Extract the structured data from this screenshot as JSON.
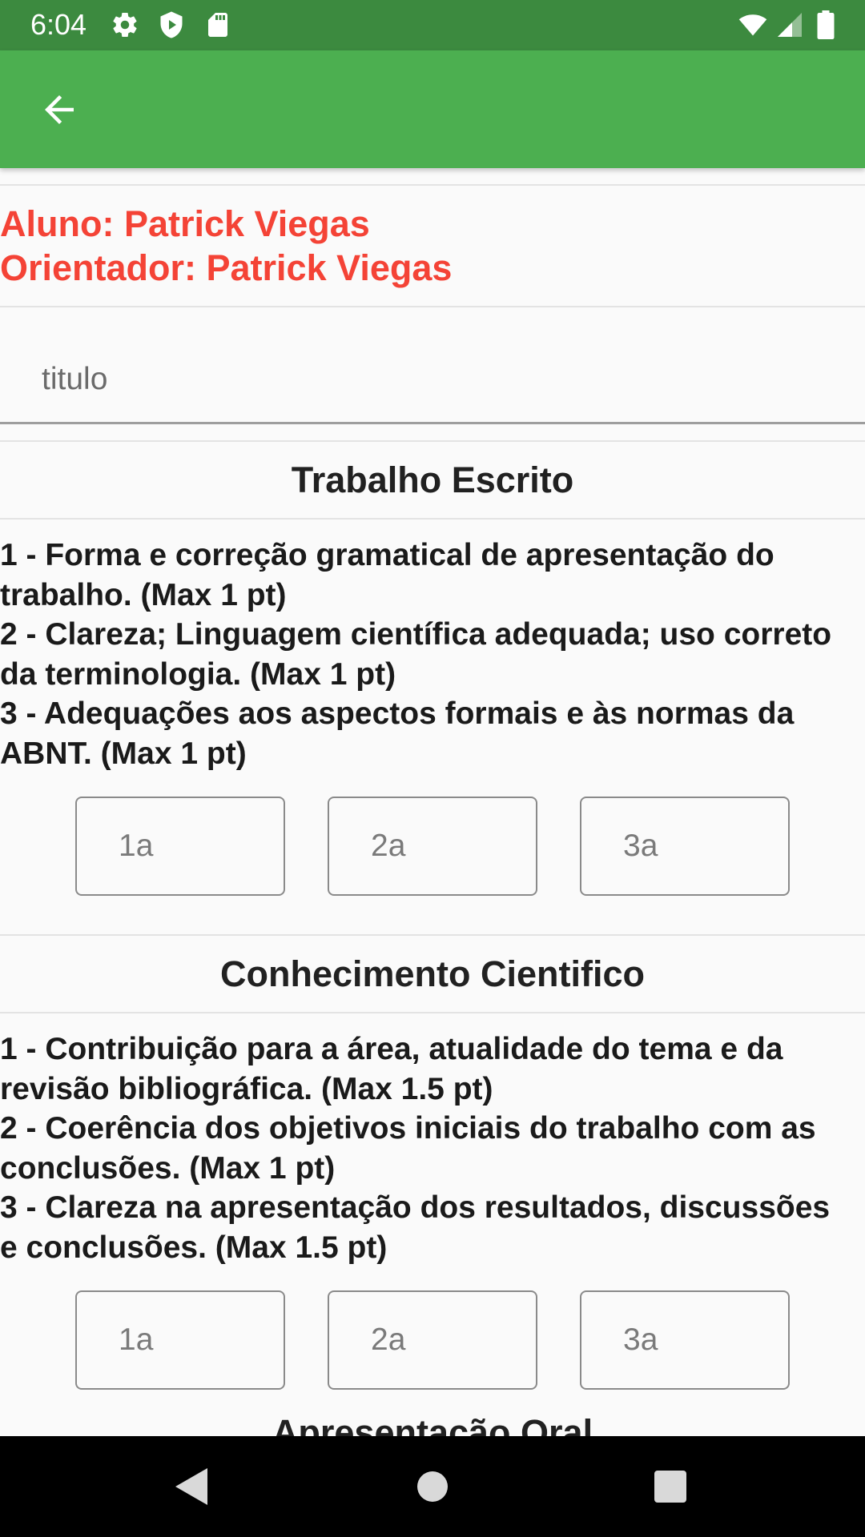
{
  "status_bar": {
    "time": "6:04",
    "left_icons": [
      "gear-icon",
      "shield-icon",
      "sd-card-icon"
    ],
    "right_icons": [
      "wifi-icon",
      "signal-icon",
      "battery-icon"
    ],
    "background": "#3c8a3f"
  },
  "app_bar": {
    "background": "#4caf50",
    "back_icon": "arrow-back-icon"
  },
  "student": {
    "aluno": "Aluno: Patrick Viegas",
    "orientador": "Orientador: Patrick Viegas",
    "color": "#f44336"
  },
  "title_field": {
    "placeholder": "titulo",
    "value": ""
  },
  "sections": [
    {
      "title": "Trabalho Escrito",
      "criteria": [
        "1 - Forma e correção gramatical de apresentação do",
        "trabalho. (Max 1 pt)",
        "2 - Clareza; Linguagem científica adequada; uso correto",
        "da terminologia. (Max 1 pt)",
        "3 - Adequações aos aspectos formais e às normas da",
        "ABNT. (Max 1 pt)"
      ],
      "inputs": [
        {
          "placeholder": "1a",
          "value": ""
        },
        {
          "placeholder": "2a",
          "value": ""
        },
        {
          "placeholder": "3a",
          "value": ""
        }
      ]
    },
    {
      "title": "Conhecimento Cientifico",
      "criteria": [
        "1 - Contribuição para a área, atualidade do tema e da",
        "revisão bibliográfica. (Max 1.5 pt)",
        "2 - Coerência dos objetivos iniciais do trabalho com as",
        "conclusões. (Max 1 pt)",
        "3 - Clareza na apresentação dos resultados, discussões",
        "e conclusões. (Max 1.5 pt)"
      ],
      "inputs": [
        {
          "placeholder": "1a",
          "value": ""
        },
        {
          "placeholder": "2a",
          "value": ""
        },
        {
          "placeholder": "3a",
          "value": ""
        }
      ]
    },
    {
      "title": "Apresentação Oral"
    }
  ],
  "nav_bar": {
    "buttons": [
      "back-triangle-icon",
      "home-circle-icon",
      "recents-square-icon"
    ]
  }
}
